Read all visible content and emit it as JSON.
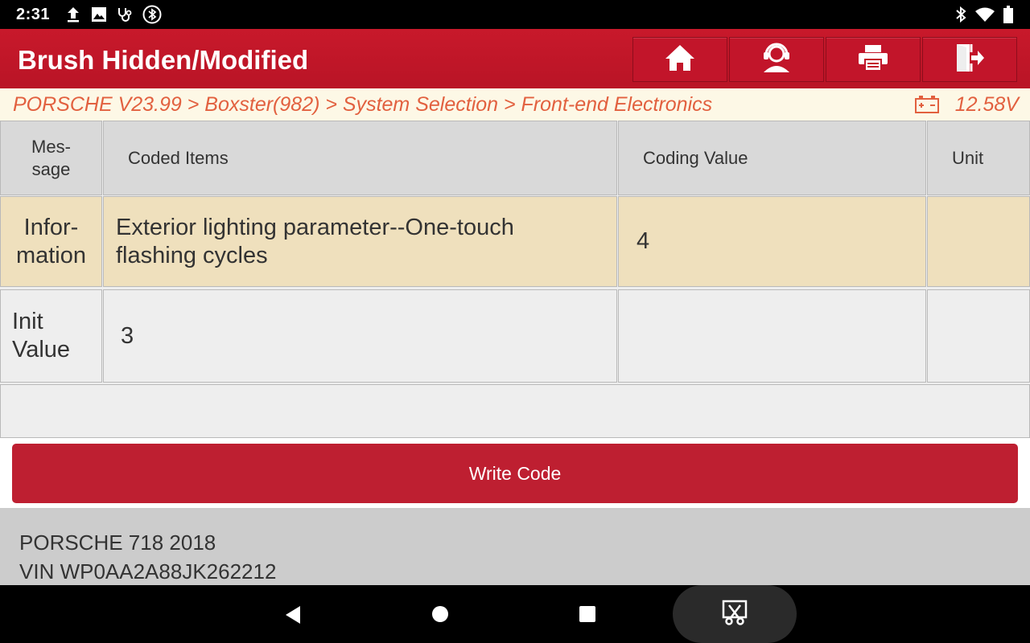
{
  "status_bar": {
    "time": "2:31",
    "icons_left": [
      "upload-icon",
      "image-icon",
      "stethoscope-icon",
      "bluetooth-circle-icon"
    ],
    "icons_right": [
      "bluetooth-icon",
      "wifi-icon",
      "battery-icon"
    ]
  },
  "header": {
    "title": "Brush Hidden/Modified",
    "buttons": [
      "home-icon",
      "support-agent-icon",
      "printer-icon",
      "exit-icon"
    ]
  },
  "breadcrumb": {
    "path": "PORSCHE V23.99 > Boxster(982) > System Selection > Front-end Electronics",
    "voltage": "12.58V"
  },
  "table": {
    "headers": {
      "message": "Mes-\nsage",
      "coded_items": "Coded Items",
      "coding_value": "Coding Value",
      "unit": "Unit"
    },
    "rows": [
      {
        "message": "Infor-\nmation",
        "coded_items": "Exterior lighting parameter--One-touch flashing cycles",
        "coding_value": "4",
        "unit": ""
      },
      {
        "message": "Init\nValue",
        "coded_items": "3",
        "coding_value": "",
        "unit": ""
      }
    ]
  },
  "actions": {
    "write_code": "Write Code"
  },
  "vehicle": {
    "model": "PORSCHE 718 2018",
    "vin": "VIN WP0AA2A88JK262212"
  },
  "colors": {
    "brand_red": "#c8192b",
    "highlight_row": "#efe0bd",
    "breadcrumb_text": "#e2603f"
  }
}
